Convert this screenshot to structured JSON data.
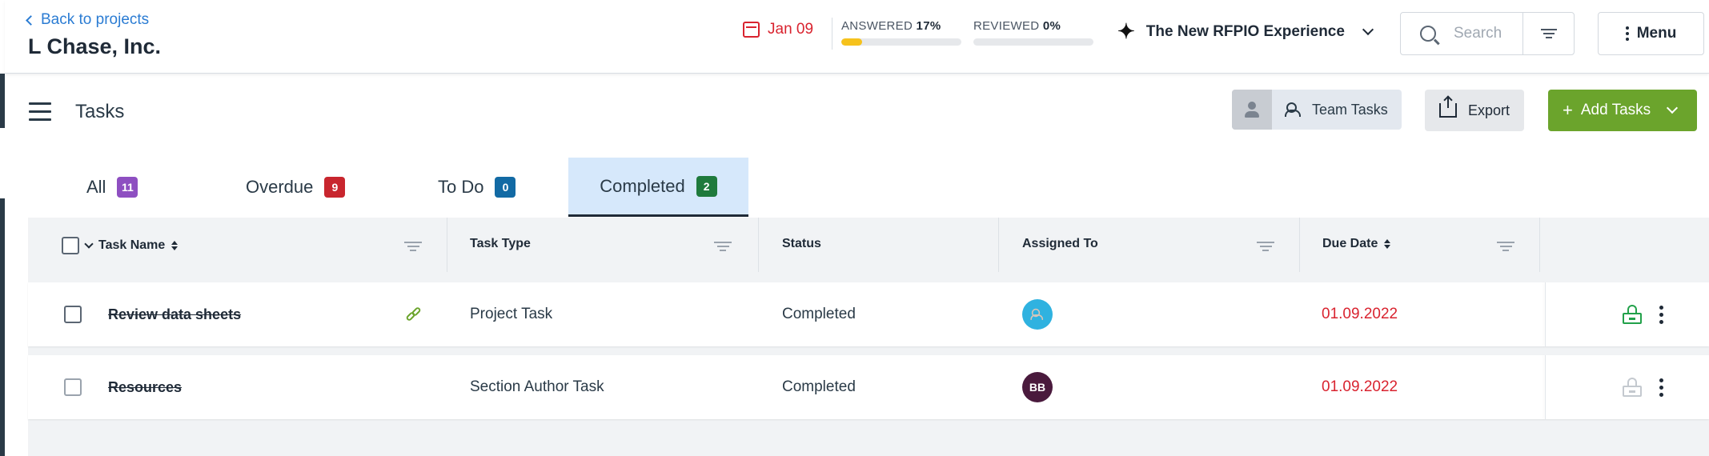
{
  "header": {
    "back_label": "Back to projects",
    "project_name": "L Chase, Inc.",
    "due_date": "Jan 09",
    "answered": {
      "label": "ANSWERED",
      "value": "17%",
      "fraction": 0.17
    },
    "reviewed": {
      "label": "REVIEWED",
      "value": "0%",
      "fraction": 0.0
    },
    "experience_label": "The New RFPIO Experience",
    "search_placeholder": "Search",
    "menu_label": "Menu"
  },
  "toolbar": {
    "page_title": "Tasks",
    "team_tasks_label": "Team Tasks",
    "export_label": "Export",
    "add_tasks_label": "Add Tasks"
  },
  "tabs": [
    {
      "label": "All",
      "count": "11",
      "color": "#8e4fc1"
    },
    {
      "label": "Overdue",
      "count": "9",
      "color": "#c8262e"
    },
    {
      "label": "To Do",
      "count": "0",
      "color": "#126aa4"
    },
    {
      "label": "Completed",
      "count": "2",
      "color": "#1f7a3c",
      "active": true
    }
  ],
  "table": {
    "columns": [
      "Task Name",
      "Task Type",
      "Status",
      "Assigned To",
      "Due Date"
    ],
    "rows": [
      {
        "name": "Review data sheets",
        "type": "Project Task",
        "status": "Completed",
        "assignee_icon": "team-icon",
        "due": "01.09.2022",
        "locked": false
      },
      {
        "name": "Resources",
        "type": "Section Author Task",
        "status": "Completed",
        "assignee": "BB",
        "due": "01.09.2022",
        "locked": true
      }
    ]
  },
  "colors": {
    "accent_blue": "#2b7cd3",
    "due_red": "#d9232f",
    "progress_yellow": "#f6c21c",
    "add_green": "#6ba42c",
    "active_tab_bg": "#d6e8fb"
  }
}
